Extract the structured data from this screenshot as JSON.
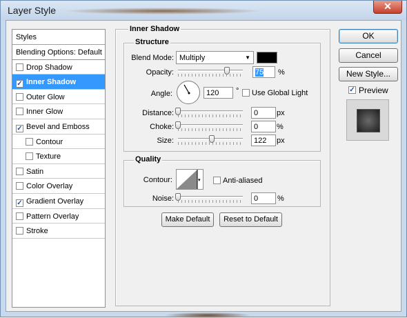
{
  "window": {
    "title": "Layer Style",
    "close_glyph": "✕"
  },
  "styles_panel": {
    "header": "Styles",
    "blending": "Blending Options: Default",
    "items": [
      {
        "label": "Drop Shadow",
        "checked": false,
        "selected": false,
        "indent": false
      },
      {
        "label": "Inner Shadow",
        "checked": true,
        "selected": true,
        "indent": false
      },
      {
        "label": "Outer Glow",
        "checked": false,
        "selected": false,
        "indent": false
      },
      {
        "label": "Inner Glow",
        "checked": false,
        "selected": false,
        "indent": false
      },
      {
        "label": "Bevel and Emboss",
        "checked": true,
        "selected": false,
        "indent": false
      },
      {
        "label": "Contour",
        "checked": false,
        "selected": false,
        "indent": true
      },
      {
        "label": "Texture",
        "checked": false,
        "selected": false,
        "indent": true
      },
      {
        "label": "Satin",
        "checked": false,
        "selected": false,
        "indent": false
      },
      {
        "label": "Color Overlay",
        "checked": false,
        "selected": false,
        "indent": false
      },
      {
        "label": "Gradient Overlay",
        "checked": true,
        "selected": false,
        "indent": false
      },
      {
        "label": "Pattern Overlay",
        "checked": false,
        "selected": false,
        "indent": false
      },
      {
        "label": "Stroke",
        "checked": false,
        "selected": false,
        "indent": false
      }
    ]
  },
  "inner_shadow": {
    "title": "Inner Shadow",
    "structure": {
      "title": "Structure",
      "blend_mode_label": "Blend Mode:",
      "blend_mode_value": "Multiply",
      "shadow_color": "#000000",
      "opacity_label": "Opacity:",
      "opacity_value": "75",
      "opacity_unit": "%",
      "angle_label": "Angle:",
      "angle_value": "120",
      "angle_unit": "°",
      "use_global_light_label": "Use Global Light",
      "use_global_light": false,
      "distance_label": "Distance:",
      "distance_value": "0",
      "distance_unit": "px",
      "choke_label": "Choke:",
      "choke_value": "0",
      "choke_unit": "%",
      "size_label": "Size:",
      "size_value": "122",
      "size_unit": "px"
    },
    "quality": {
      "title": "Quality",
      "contour_label": "Contour:",
      "anti_aliased_label": "Anti-aliased",
      "anti_aliased": false,
      "noise_label": "Noise:",
      "noise_value": "0",
      "noise_unit": "%"
    },
    "make_default": "Make Default",
    "reset_default": "Reset to Default"
  },
  "actions": {
    "ok": "OK",
    "cancel": "Cancel",
    "new_style": "New Style...",
    "preview_label": "Preview",
    "preview_checked": true
  }
}
